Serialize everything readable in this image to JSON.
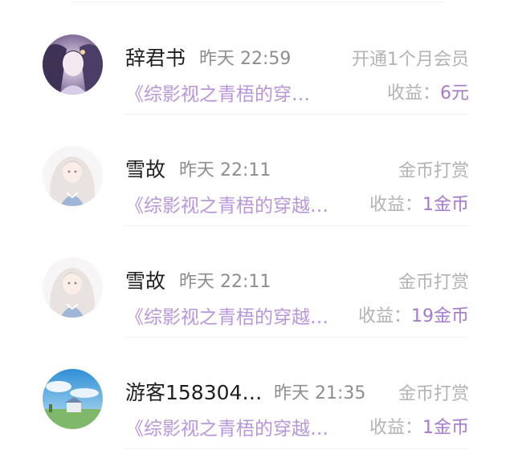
{
  "records": [
    {
      "name": "辞君书",
      "time": "昨天 22:59",
      "type": "开通1个月会员",
      "book": "《综影视之青梧的穿…",
      "earn_label": "收益：",
      "earn_value": "6元",
      "avatar_icon": "avatar-dark-anime-girl"
    },
    {
      "name": "雪故",
      "time": "昨天 22:11",
      "type": "金币打赏",
      "book": "《综影视之青梧的穿越…",
      "earn_label": "收益：",
      "earn_value": "1金币",
      "avatar_icon": "avatar-white-hair-girl"
    },
    {
      "name": "雪故",
      "time": "昨天 22:11",
      "type": "金币打赏",
      "book": "《综影视之青梧的穿越…",
      "earn_label": "收益：",
      "earn_value": "19金币",
      "avatar_icon": "avatar-white-hair-girl"
    },
    {
      "name": "游客158304…",
      "time": "昨天 21:35",
      "type": "金币打赏",
      "book": "《综影视之青梧的穿越…",
      "earn_label": "收益：",
      "earn_value": "1金币",
      "avatar_icon": "avatar-sky-landscape"
    }
  ],
  "colors": {
    "accent": "#a57ad0",
    "book_title": "#b996dc",
    "muted": "#b3b3b3",
    "time": "#8e8e8e"
  }
}
